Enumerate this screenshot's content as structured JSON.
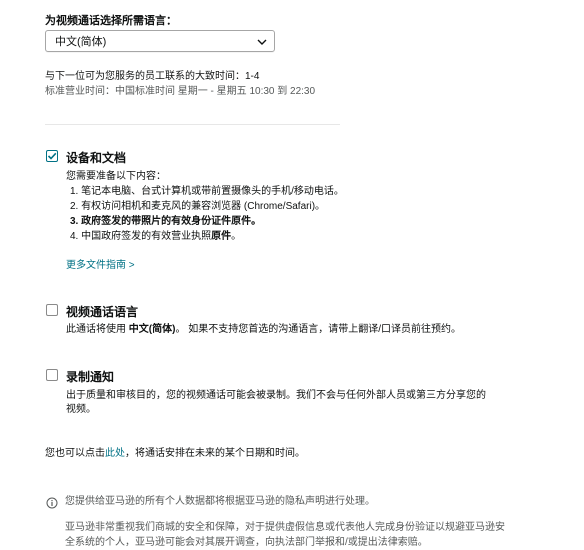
{
  "language_selector": {
    "label": "为视频通话选择所需语言：",
    "selected": "中文(简体)"
  },
  "availability": {
    "wait_time": "与下一位可为您服务的员工联系的大致时间：1-4",
    "hours": "标准营业时间：中国标准时间 星期一 - 星期五 10:30 到 22:30"
  },
  "devices": {
    "title": "设备和文档",
    "intro": "您需要准备以下内容：",
    "items": [
      {
        "text": "1. 笔记本电脑、台式计算机或带前置摄像头的手机/移动电话。"
      },
      {
        "text": "2. 有权访问相机和麦克风的兼容浏览器 (Chrome/Safari)。"
      },
      {
        "text": "3. 政府签发的带照片的有效身份证件原件。"
      },
      {
        "pre": "4. 中国政府签发的有效营业执照",
        "strong": "原件",
        "post": "。"
      }
    ],
    "more_link": "更多文件指南 >"
  },
  "video_language": {
    "title": "视频通话语言",
    "pre": "此通话将使用 ",
    "lang": "中文(简体)",
    "post": "。 如果不支持您首选的沟通语言，请带上翻译/口译员前往预约。"
  },
  "recording": {
    "title": "录制通知",
    "line1": "出于质量和审核目的，您的视频通话可能会被录制。我们不会与任何外部人员或第三方分享您的",
    "line2": "视频。"
  },
  "schedule": {
    "pre": "您也可以点击",
    "link": "此处",
    "post": "，将通话安排在未来的某个日期和时间。"
  },
  "privacy": {
    "note": "您提供给亚马逊的所有个人数据都将根据亚马逊的隐私声明进行处理。",
    "line1": "亚马逊非常重视我们商城的安全和保障，对于提供虚假信息或代表他人完成身份验证以规避亚马逊安",
    "line2": "全系统的个人，亚马逊可能会对其展开调查，向执法部门举报和/或提出法律索赔。"
  },
  "colors": {
    "accent": "#007185",
    "text": "#0f1111",
    "muted": "#565959"
  }
}
